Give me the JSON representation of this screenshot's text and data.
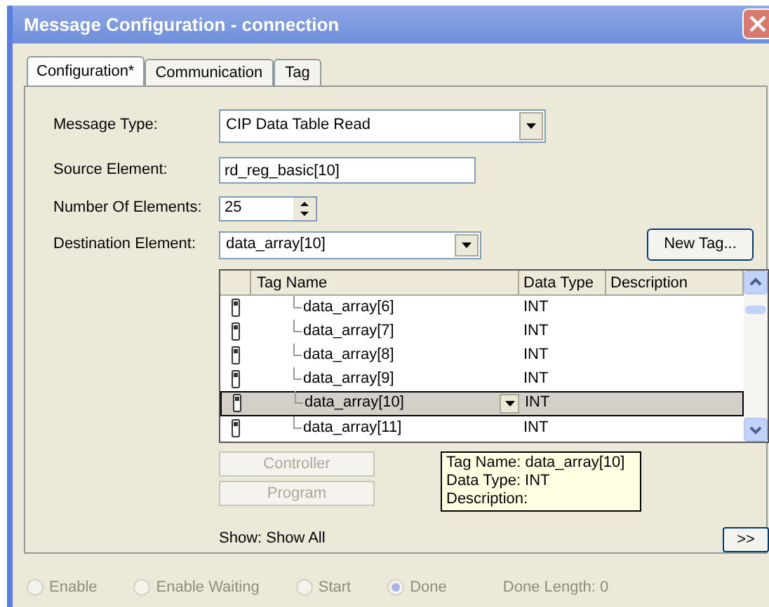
{
  "window": {
    "title": "Message Configuration - connection"
  },
  "tabs": [
    {
      "label": "Configuration*",
      "selected": true
    },
    {
      "label": "Communication",
      "selected": false
    },
    {
      "label": "Tag",
      "selected": false
    }
  ],
  "form": {
    "message_type": {
      "label": "Message Type:",
      "value": "CIP Data Table Read"
    },
    "source_element": {
      "label": "Source Element:",
      "value": "rd_reg_basic[10]"
    },
    "number_of_elements": {
      "label": "Number Of Elements:",
      "value": "25"
    },
    "destination_element": {
      "label": "Destination Element:",
      "value": "data_array[10]"
    },
    "new_tag_button": "New Tag..."
  },
  "tag_browser": {
    "columns": [
      "Tag Name",
      "Data Type",
      "Description"
    ],
    "rows": [
      {
        "tag": "data_array[6]",
        "data_type": "INT",
        "selected": false
      },
      {
        "tag": "data_array[7]",
        "data_type": "INT",
        "selected": false
      },
      {
        "tag": "data_array[8]",
        "data_type": "INT",
        "selected": false
      },
      {
        "tag": "data_array[9]",
        "data_type": "INT",
        "selected": false
      },
      {
        "tag": "data_array[10]",
        "data_type": "INT",
        "selected": true
      },
      {
        "tag": "data_array[11]",
        "data_type": "INT",
        "selected": false
      }
    ],
    "scope_buttons": [
      {
        "label": "Controller",
        "disabled": true
      },
      {
        "label": "Program",
        "disabled": true
      }
    ],
    "tooltip": [
      "Tag Name: data_array[10]",
      "Data Type: INT",
      "Description:"
    ],
    "show": "Show: Show All",
    "more_button": ">>"
  },
  "status_bar": {
    "disabled": true,
    "items": [
      {
        "kind": "radio",
        "label": "Enable",
        "selected": false
      },
      {
        "kind": "radio",
        "label": "Enable Waiting",
        "selected": false
      },
      {
        "kind": "radio",
        "label": "Start",
        "selected": false
      },
      {
        "kind": "radio",
        "label": "Done",
        "selected": true
      },
      {
        "kind": "text",
        "label": "Done Length: 0"
      }
    ]
  }
}
